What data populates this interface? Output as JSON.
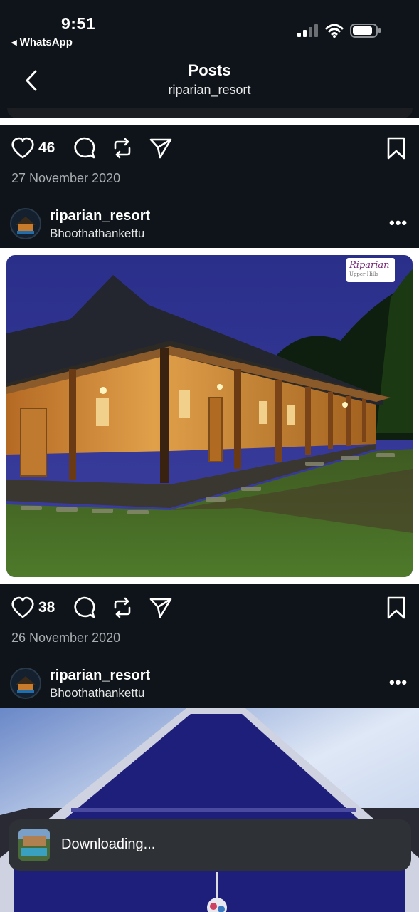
{
  "status_bar": {
    "time": "9:51",
    "back_app": "◂ WhatsApp",
    "icons": [
      "signal-icon",
      "wifi-icon",
      "battery-icon"
    ]
  },
  "header": {
    "title": "Posts",
    "subtitle": "riparian_resort",
    "back_icon": "chevron-left-icon"
  },
  "posts": [
    {
      "likes": "46",
      "date": "27 November 2020",
      "actions": [
        "heart-icon",
        "comment-icon",
        "repost-icon",
        "send-icon",
        "bookmark-icon"
      ]
    },
    {
      "username": "riparian_resort",
      "location": "Bhoothathankettu",
      "more": "•••",
      "image_logo": "Riparian",
      "image_logo_sub": "Upper Hills",
      "likes": "38",
      "date": "26 November 2020",
      "actions": [
        "heart-icon",
        "comment-icon",
        "repost-icon",
        "send-icon",
        "bookmark-icon"
      ]
    },
    {
      "username": "riparian_resort",
      "location": "Bhoothathankettu",
      "more": "•••"
    }
  ],
  "toast": {
    "text": "Downloading..."
  },
  "colors": {
    "background": "#0e1419",
    "toast": "#2e3136",
    "date_text": "#a9adb2"
  }
}
